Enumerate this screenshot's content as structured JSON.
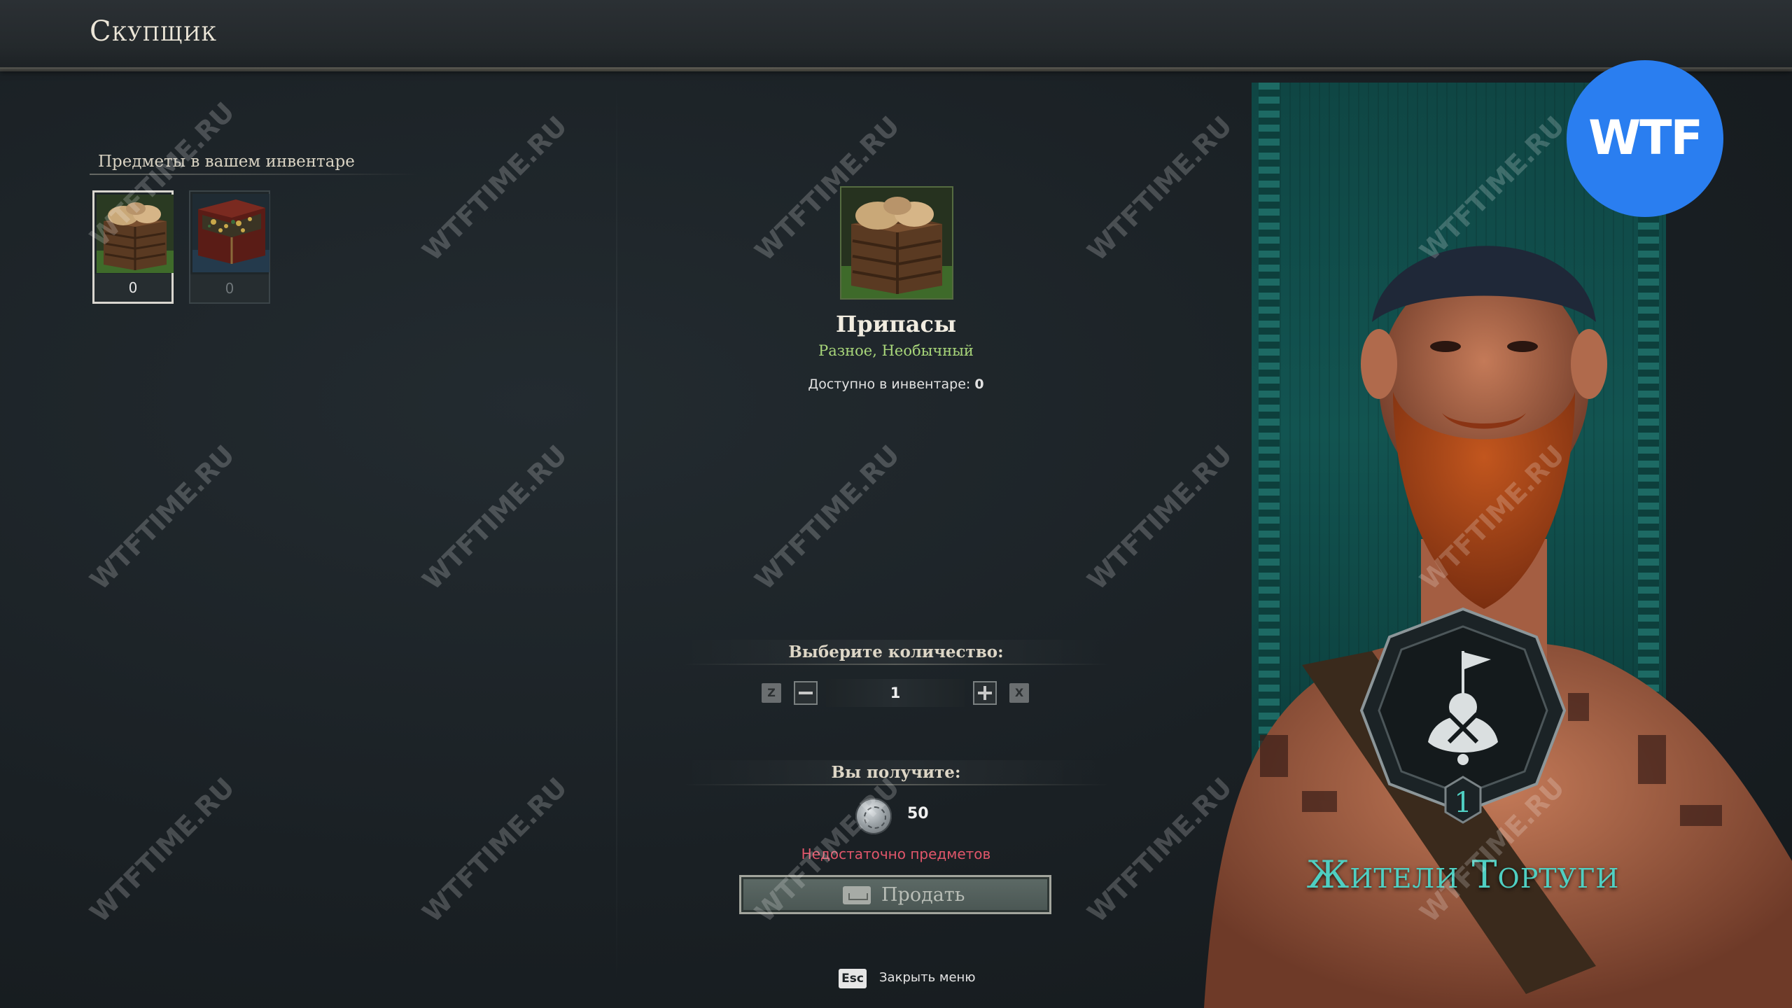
{
  "header": {
    "title": "Скупщик"
  },
  "inventory": {
    "label": "Предметы в вашем инвентаре",
    "slots": [
      {
        "name": "Припасы",
        "qty": "0",
        "icon": "supply-crate-icon",
        "selected": true
      },
      {
        "name": "treasure-chest",
        "qty": "0",
        "icon": "treasure-chest-icon",
        "selected": false
      }
    ]
  },
  "item": {
    "icon": "supply-crate-icon",
    "name": "Припасы",
    "subtitle": "Разное, Необычный",
    "available_label": "Доступно в инвентаре:",
    "available_value": "0"
  },
  "quantity": {
    "title": "Выберите количество:",
    "key_min": "Z",
    "key_max": "X",
    "minus_icon": "minus-icon",
    "plus_icon": "plus-icon",
    "value": "1"
  },
  "reward": {
    "title": "Вы получите:",
    "icon": "silver-coin-icon",
    "value": "50",
    "warning": "Недостаточно предметов"
  },
  "sell_button": {
    "label": "Продать",
    "icon": "keyboard-icon"
  },
  "footer": {
    "esc_key": "Esc",
    "close_label": "Закрыть меню"
  },
  "faction": {
    "name": "Жители Тортуги",
    "level": "1",
    "icon": "faction-emblem-icon"
  },
  "badge": {
    "text": "WTF"
  },
  "watermark_text": "WTFTIME.RU",
  "colors": {
    "accent": "#4fcfc2",
    "uncommon": "#a8d67a",
    "warning": "#e0566a",
    "badge": "#2a7ef0"
  }
}
